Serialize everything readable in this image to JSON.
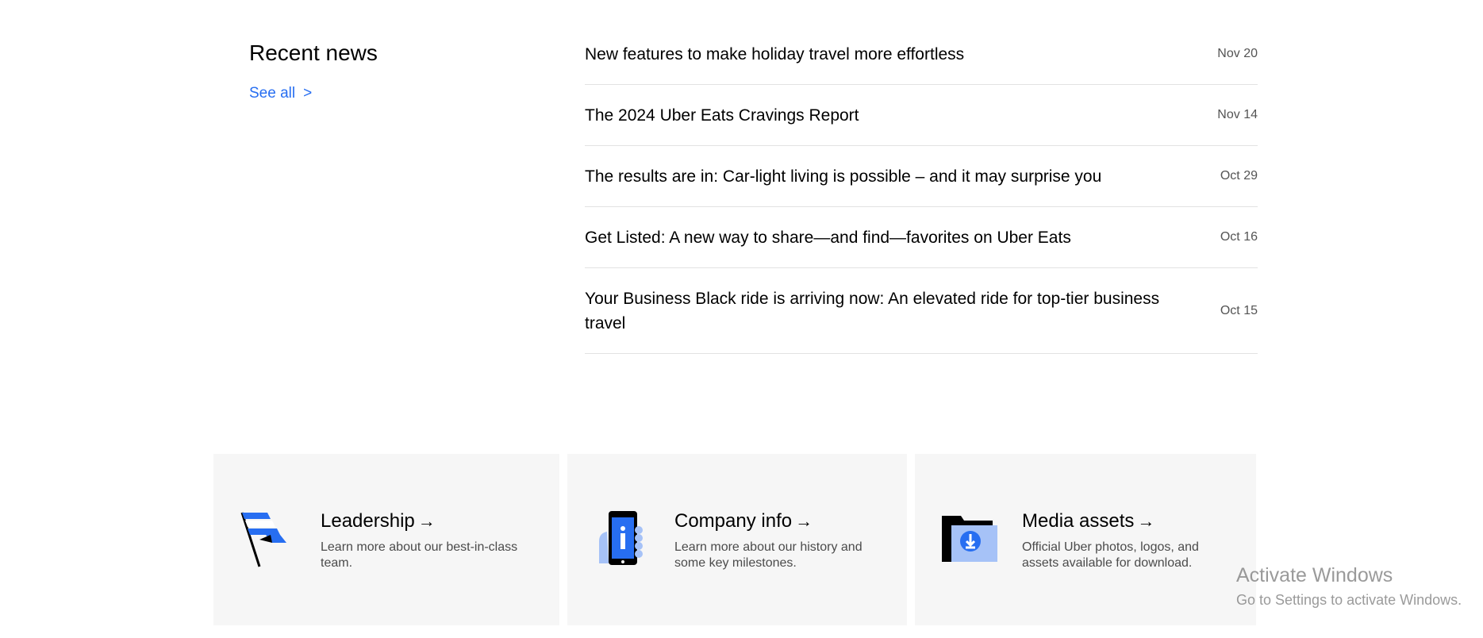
{
  "recent_news": {
    "heading": "Recent news",
    "see_all": "See all",
    "see_all_chevron": ">",
    "items": [
      {
        "title": "New features to make holiday travel more effortless",
        "date": "Nov 20"
      },
      {
        "title": "The 2024 Uber Eats Cravings Report",
        "date": "Nov 14"
      },
      {
        "title": "The results are in: Car-light living is possible – and it may surprise you",
        "date": "Oct 29"
      },
      {
        "title": "Get Listed: A new way to share—and find—favorites on Uber Eats",
        "date": "Oct 16"
      },
      {
        "title": "Your Business Black ride is arriving now: An elevated ride for top-tier business travel",
        "date": "Oct 15"
      }
    ]
  },
  "cards": [
    {
      "title": "Leadership",
      "arrow": "→",
      "description": "Learn more about our best-in-class team.",
      "icon": "flag-icon"
    },
    {
      "title": "Company info",
      "arrow": "→",
      "description": "Learn more about our history and some key milestones.",
      "icon": "phone-info-icon"
    },
    {
      "title": "Media assets",
      "arrow": "→",
      "description": "Official Uber photos, logos, and assets available for download.",
      "icon": "folder-download-icon"
    }
  ],
  "watermark": {
    "title": "Activate Windows",
    "subtitle": "Go to Settings to activate Windows."
  },
  "colors": {
    "link": "#276EF1",
    "icon_blue": "#276EF1",
    "icon_light_blue": "#A6C2F7",
    "card_bg": "#F6F6F6"
  }
}
